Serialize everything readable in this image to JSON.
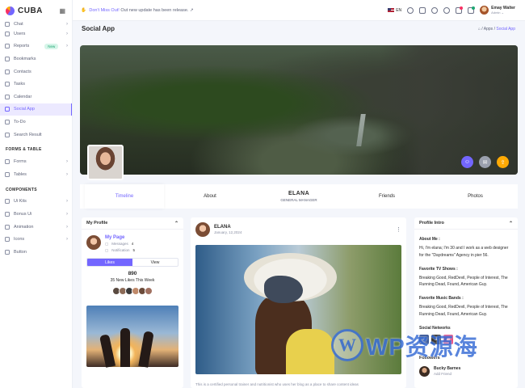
{
  "app": {
    "name": "CUBA"
  },
  "sidebar": {
    "items": [
      {
        "label": "Chat",
        "chevron": true
      },
      {
        "label": "Users",
        "chevron": true
      },
      {
        "label": "Reports",
        "badge": "New",
        "chevron": true
      },
      {
        "label": "Bookmarks"
      },
      {
        "label": "Contacts"
      },
      {
        "label": "Tasks"
      },
      {
        "label": "Calendar"
      },
      {
        "label": "Social App",
        "active": true
      },
      {
        "label": "To-Do"
      },
      {
        "label": "Search Result"
      }
    ],
    "section_forms": "FORMS & TABLE",
    "forms_items": [
      {
        "label": "Forms",
        "chevron": true
      },
      {
        "label": "Tables",
        "chevron": true
      }
    ],
    "section_components": "COMPONENTS",
    "component_items": [
      {
        "label": "Ui Kits",
        "chevron": true
      },
      {
        "label": "Bonus Ui",
        "chevron": true
      },
      {
        "label": "Animation",
        "chevron": true
      },
      {
        "label": "Icons",
        "chevron": true
      },
      {
        "label": "Button"
      }
    ]
  },
  "topbar": {
    "notice_prefix": "Don't Miss Out!",
    "notice_text": " Out new update has been release.",
    "notice_link": "↗",
    "language": "EN",
    "user_name": "Emay Walter",
    "user_role": "Admin ⌄"
  },
  "page": {
    "title": "Social App",
    "breadcrumb": [
      "⌂",
      "/",
      "Apps",
      "/",
      "Social App"
    ]
  },
  "tabs": {
    "timeline": "Timeline",
    "about": "About",
    "name": "ELANA",
    "role": "GENERAL MANAGER",
    "friends": "Friends",
    "photos": "Photos"
  },
  "my_profile": {
    "title": "My Profile",
    "link": "My Page",
    "messages_label": "Messages",
    "messages_count": "4",
    "notification_label": "Notification",
    "notification_count": "5",
    "likes_button": "Likes",
    "view_button": "View",
    "likes_count": "890",
    "likes_text": "35 New Likes This Week"
  },
  "post": {
    "author": "ELANA",
    "date": "January, 12,2024",
    "caption": "This is a certified personal trainer and nutritionist who uses her blog as a place to share content ideas"
  },
  "profile_intro": {
    "title": "Profile Intro",
    "about_heading": "About Me :",
    "about_text": "Hi, I'm elana; I'm 30 and I work as a web designer for the \"Daydreams\" Agency in pier 56.",
    "tv_heading": "Favorite TV Shows :",
    "tv_text": "Breaking Good, RedDevil, People of Interest, The Running Dead, Found, American Guy.",
    "music_heading": "Favorite Music Bands :",
    "music_text": "Breaking Good, RedDevil, People of Interest, The Running Dead, Found, American Guy.",
    "social_heading": "Social Networks",
    "socials": [
      "f",
      "X",
      "◎"
    ],
    "followers_heading": "Followers",
    "follower_name": "Bucky Barnes",
    "follower_sub": "Add Friend"
  },
  "watermark": {
    "logo": "W",
    "text": "WP资源海"
  },
  "colors": {
    "accent": "#7366ff",
    "facebook": "#3b5998",
    "x": "#2b2b2b",
    "instagram": "#e8457c",
    "fab_warning": "#ffaa05"
  }
}
